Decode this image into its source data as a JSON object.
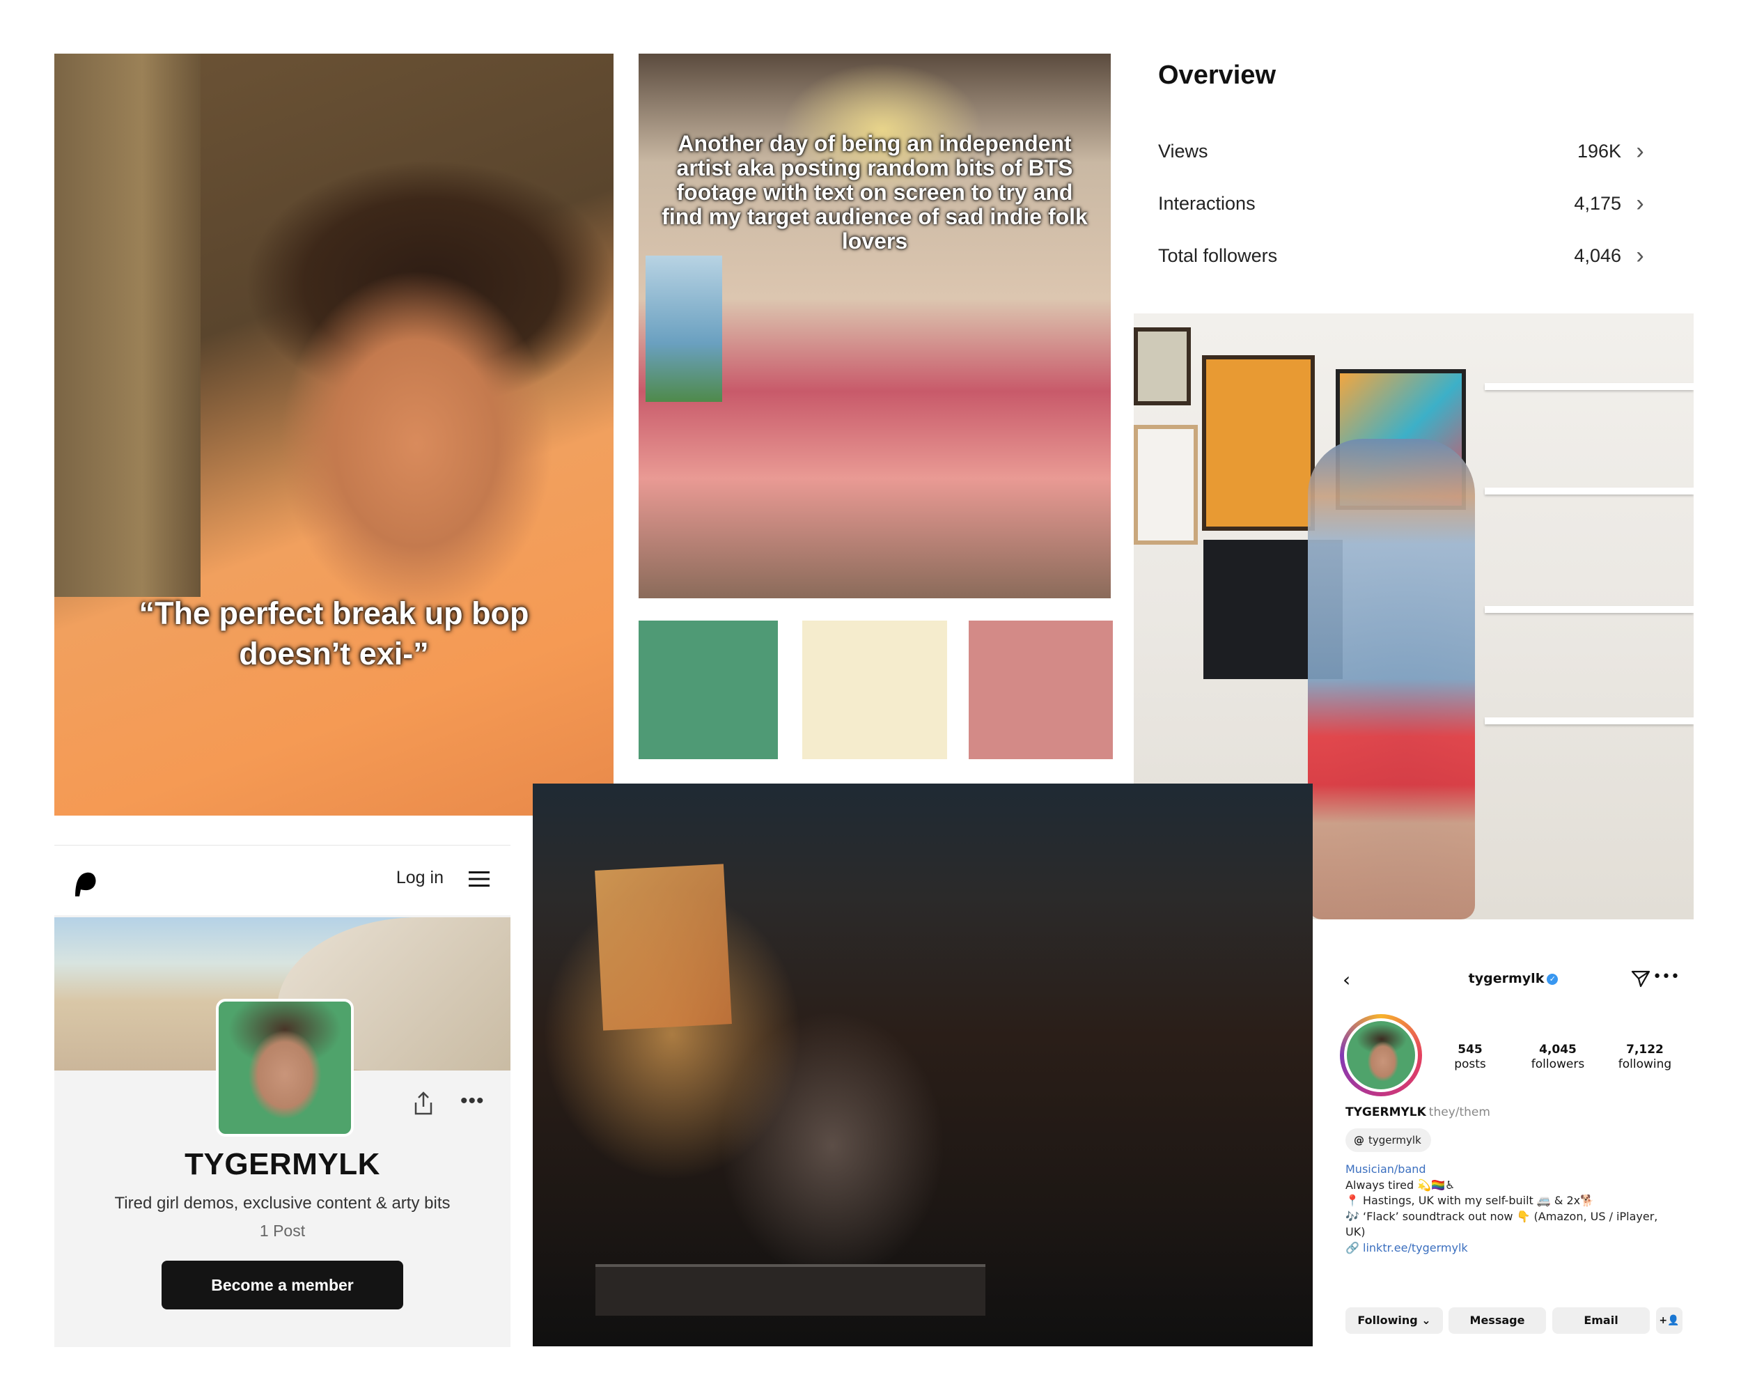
{
  "photo_selfie": {
    "caption_line1": "“The perfect break up bop",
    "caption_line2": "doesn’t exi-”"
  },
  "photo_van": {
    "caption": "Another day of being an independent artist aka posting random bits of BTS footage with text on screen to try and find my target audience of sad indie folk lovers"
  },
  "palette": {
    "swatch1": "#4F9A75",
    "swatch2": "#F5ECCD",
    "swatch3": "#D38A87"
  },
  "overview": {
    "title": "Overview",
    "rows": [
      {
        "label": "Views",
        "value": "196K"
      },
      {
        "label": "Interactions",
        "value": "4,175"
      },
      {
        "label": "Total followers",
        "value": "4,046"
      }
    ]
  },
  "patreon": {
    "login": "Log in",
    "name": "TYGERMYLK",
    "tagline": "Tired girl demos, exclusive content & arty bits",
    "posts": "1 Post",
    "cta": "Become a member",
    "accent": "#141414"
  },
  "instagram": {
    "username": "tygermylk",
    "stats": [
      {
        "value": "545",
        "label": "posts"
      },
      {
        "value": "4,045",
        "label": "followers"
      },
      {
        "value": "7,122",
        "label": "following"
      }
    ],
    "display_name": "TYGERMYLK",
    "pronouns": "they/them",
    "threads_handle": "tygermylk",
    "category": "Musician/band",
    "bio_line1": "Always tired 💫🏳️‍🌈♿",
    "bio_line2": "📍 Hastings, UK with my self-built 🚐 & 2x🐕",
    "bio_line3": "🎶 ‘Flack’ soundtrack out now 👇 (Amazon, US / iPlayer, UK)",
    "link": "linktr.ee/tygermylk",
    "buttons": {
      "following": "Following ⌄",
      "message": "Message",
      "email": "Email"
    },
    "verified_color": "#3897F0",
    "link_color": "#3B6FBF"
  }
}
